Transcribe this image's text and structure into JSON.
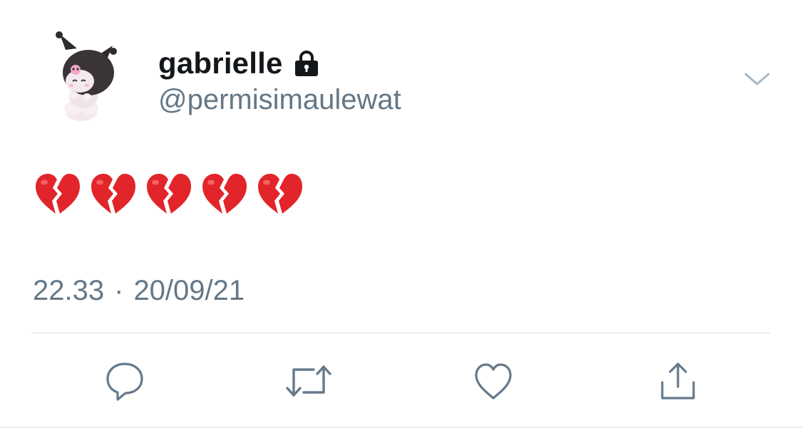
{
  "tweet": {
    "display_name": "gabrielle",
    "handle": "@permisimaulewat",
    "protected_icon": "lock-icon",
    "text_emojis": [
      "broken-heart",
      "broken-heart",
      "broken-heart",
      "broken-heart",
      "broken-heart"
    ],
    "time": "22.33",
    "separator": "·",
    "date": "20/09/21"
  },
  "actions": [
    {
      "name": "reply-icon"
    },
    {
      "name": "retweet-icon"
    },
    {
      "name": "like-icon"
    },
    {
      "name": "share-icon"
    }
  ],
  "colors": {
    "name": "#14171a",
    "secondary": "#657786",
    "icon": "#667a8c",
    "divider": "#d6dbdf",
    "heart_red": "#e1252a"
  }
}
